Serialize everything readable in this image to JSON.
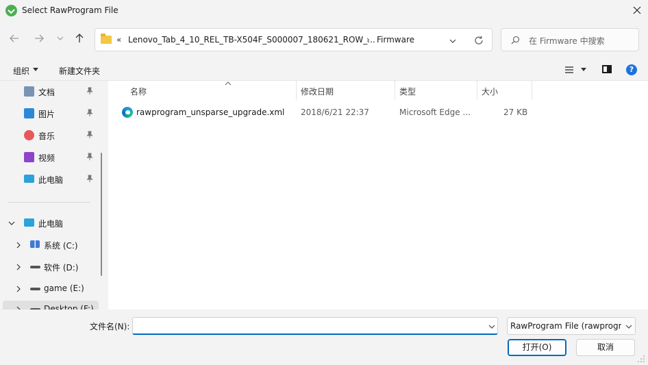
{
  "window": {
    "title": "Select RawProgram File"
  },
  "address": {
    "overflow": "«",
    "path": [
      "Lenovo_Tab_4_10_REL_TB-X504F_S000007_180621_ROW_...",
      "Firmware"
    ],
    "separator": "›"
  },
  "search": {
    "placeholder": "在 Firmware 中搜索"
  },
  "toolbar": {
    "organize": "组织",
    "new_folder": "新建文件夹"
  },
  "sidebar": {
    "quick_access": [
      {
        "label": "文档",
        "icon": "documents-icon",
        "color": "#5a7fa8"
      },
      {
        "label": "图片",
        "icon": "pictures-icon",
        "color": "#2b88d8"
      },
      {
        "label": "音乐",
        "icon": "music-icon",
        "color": "#e8575a"
      },
      {
        "label": "视频",
        "icon": "videos-icon",
        "color": "#8e44c8"
      },
      {
        "label": "此电脑",
        "icon": "this-pc-icon",
        "color": "#2aa3d8"
      }
    ],
    "tree": [
      {
        "label": "此电脑",
        "icon": "this-pc-icon",
        "expanded": true
      },
      {
        "label": "系统 (C:)",
        "icon": "windows-drive-icon"
      },
      {
        "label": "软件 (D:)",
        "icon": "drive-icon"
      },
      {
        "label": "game (E:)",
        "icon": "drive-icon"
      },
      {
        "label": "Desktop (F:)",
        "icon": "drive-icon"
      }
    ]
  },
  "columns": {
    "name": "名称",
    "modified": "修改日期",
    "type": "类型",
    "size": "大小"
  },
  "files": [
    {
      "name": "rawprogram_unsparse_upgrade.xml",
      "modified": "2018/6/21 22:37",
      "type": "Microsoft Edge ...",
      "size": "27 KB",
      "icon": "edge-icon"
    }
  ],
  "footer": {
    "filename_label": "文件名(N):",
    "filename_value": "",
    "filetype": "RawProgram File (rawprogram*.xml)",
    "open_button": "打开(O)",
    "cancel_button": "取消"
  },
  "colors": {
    "accent": "#0067c0",
    "background": "#f3f3f3"
  }
}
